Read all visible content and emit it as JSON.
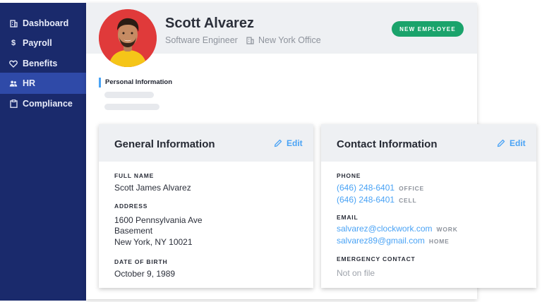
{
  "sidebar": {
    "items": [
      {
        "label": "Dashboard",
        "icon": "building-icon",
        "active": false
      },
      {
        "label": "Payroll",
        "icon": "dollar-icon",
        "active": false
      },
      {
        "label": "Benefits",
        "icon": "heart-icon",
        "active": false
      },
      {
        "label": "HR",
        "icon": "people-icon",
        "active": true
      },
      {
        "label": "Compliance",
        "icon": "clipboard-icon",
        "active": false
      }
    ]
  },
  "employee": {
    "name": "Scott Alvarez",
    "role": "Software Engineer",
    "office": "New York Office",
    "badge": "NEW EMPLOYEE"
  },
  "section": {
    "label": "Personal Information"
  },
  "general": {
    "title": "General Information",
    "edit_label": "Edit",
    "full_name_label": "FULL NAME",
    "full_name": "Scott James Alvarez",
    "address_label": "ADDRESS",
    "address_line1": "1600 Pennsylvania Ave",
    "address_line2": "Basement",
    "address_line3": "New York, NY 10021",
    "dob_label": "DATE OF BIRTH",
    "dob": "October 9, 1989"
  },
  "contact": {
    "title": "Contact Information",
    "edit_label": "Edit",
    "phone_label": "PHONE",
    "phones": [
      {
        "value": "(646) 248-6401",
        "tag": "OFFICE"
      },
      {
        "value": "(646) 248-6401",
        "tag": "CELL"
      }
    ],
    "email_label": "EMAIL",
    "emails": [
      {
        "value": "salvarez@clockwork.com",
        "tag": "WORK"
      },
      {
        "value": "salvarez89@gmail.com",
        "tag": "HOME"
      }
    ],
    "emergency_label": "EMERGENCY CONTACT",
    "emergency_value": "Not on file"
  },
  "colors": {
    "sidebar_bg": "#1a2a6c",
    "sidebar_active": "#2f4aa8",
    "accent": "#4aa3f5",
    "badge_green": "#1aa36b",
    "avatar_bg": "#e03a3a"
  }
}
